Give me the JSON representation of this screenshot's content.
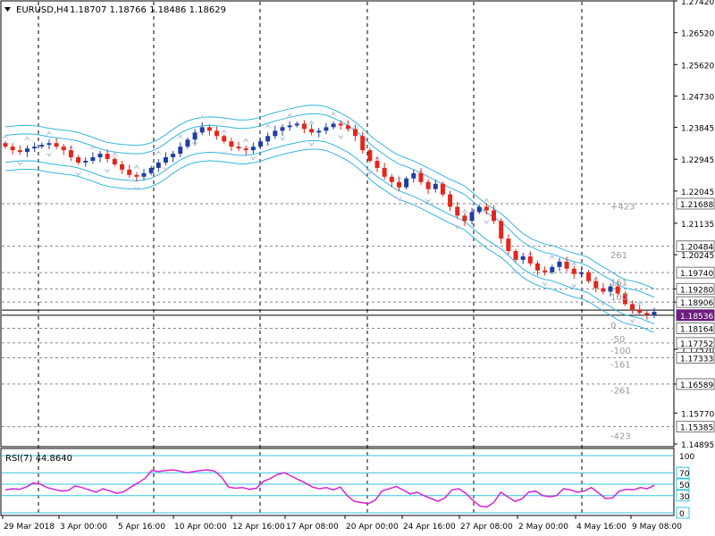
{
  "header": {
    "symbol_label": "EURUSD,H4",
    "ohlc": "1.18707 1.18766 1.18486 1.18629",
    "dropdown_icon": "triangle-down-icon"
  },
  "rsi_panel": {
    "label": "RSI(7) 44.8640",
    "levels": [
      "100",
      "70",
      "50",
      "30",
      "0"
    ],
    "highlighted_levels": [
      "70",
      "50",
      "30",
      "0"
    ]
  },
  "colors": {
    "bull_candle": "#1f3fa0",
    "bear_candle": "#e3261b",
    "bollinger": "#35b5e0",
    "fractal": "#b8c8df",
    "rsi_line": "#d424d4",
    "rsi_level": "#35c3e0",
    "price_label_bg": "#ffffff",
    "current_price_bg": "#6b1f7e"
  },
  "chart_data": {
    "type": "candlestick",
    "symbol": "EURUSD",
    "timeframe": "H4",
    "y_axis_ticks": [
      "1.27420",
      "1.26520",
      "1.25620",
      "1.24730",
      "1.23845",
      "1.22945",
      "1.22045",
      "1.21135",
      "1.20245",
      "1.19280",
      "1.18906",
      "1.17570",
      "1.16589",
      "1.15770",
      "1.14895"
    ],
    "x_axis_ticks": [
      "29 Mar 2018",
      "3 Apr 00:00",
      "5 Apr 16:00",
      "10 Apr 00:00",
      "12 Apr 16:00",
      "17 Apr 08:00",
      "20 Apr 00:00",
      "24 Apr 16:00",
      "27 Apr 08:00",
      "2 May 00:00",
      "4 May 16:00",
      "9 May 08:00"
    ],
    "price_labels": [
      {
        "value": "1.21688",
        "type": "level"
      },
      {
        "value": "1.20484",
        "type": "level"
      },
      {
        "value": "1.19740",
        "type": "level"
      },
      {
        "value": "1.19280",
        "type": "level"
      },
      {
        "value": "1.18906",
        "type": "level"
      },
      {
        "value": "1.18536",
        "type": "current"
      },
      {
        "value": "1.18164",
        "type": "level"
      },
      {
        "value": "1.17752",
        "type": "level"
      },
      {
        "value": "1.17333",
        "type": "level"
      },
      {
        "value": "1.16589",
        "type": "level"
      },
      {
        "value": "1.15385",
        "type": "level"
      }
    ],
    "fibo_labels": [
      {
        "text": "+423",
        "price": 1.2163
      },
      {
        "text": "261",
        "price": 1.2025
      },
      {
        "text": "161",
        "price": 1.1948
      },
      {
        "text": "100",
        "price": 1.1906
      },
      {
        "text": "0",
        "price": 1.1826
      },
      {
        "text": "-50",
        "price": 1.1788
      },
      {
        "text": "-100",
        "price": 1.1755
      },
      {
        "text": "-161",
        "price": 1.1715
      },
      {
        "text": "-261",
        "price": 1.1642
      },
      {
        "text": "-423",
        "price": 1.1514
      }
    ],
    "candles_close": [
      1.233,
      1.232,
      1.2315,
      1.2325,
      1.233,
      1.2335,
      1.234,
      1.233,
      1.232,
      1.23,
      1.2285,
      1.229,
      1.23,
      1.231,
      1.2295,
      1.228,
      1.2265,
      1.225,
      1.2245,
      1.2255,
      1.227,
      1.2285,
      1.23,
      1.231,
      1.233,
      1.235,
      1.237,
      1.2385,
      1.2375,
      1.236,
      1.2345,
      1.233,
      1.2325,
      1.232,
      1.233,
      1.2345,
      1.236,
      1.2375,
      1.2385,
      1.239,
      1.2395,
      1.238,
      1.237,
      1.2375,
      1.2385,
      1.2395,
      1.239,
      1.238,
      1.236,
      1.232,
      1.229,
      1.227,
      1.2245,
      1.223,
      1.2215,
      1.224,
      1.2255,
      1.223,
      1.221,
      1.2225,
      1.2195,
      1.216,
      1.2135,
      1.212,
      1.2145,
      1.216,
      1.215,
      1.212,
      1.207,
      1.2035,
      1.201,
      1.202,
      1.2,
      1.198,
      1.1975,
      1.199,
      1.2005,
      1.1985,
      1.197,
      1.1975,
      1.195,
      1.193,
      1.192,
      1.1935,
      1.1915,
      1.1885,
      1.187,
      1.186,
      1.1855,
      1.1863
    ],
    "rsi_values": [
      40,
      42,
      41,
      45,
      52,
      50,
      44,
      41,
      38,
      39,
      47,
      44,
      40,
      36,
      42,
      38,
      34,
      37,
      45,
      52,
      60,
      74,
      72,
      74,
      75,
      73,
      70,
      72,
      74,
      75,
      73,
      62,
      45,
      43,
      44,
      41,
      43,
      55,
      60,
      67,
      70,
      64,
      58,
      52,
      45,
      42,
      44,
      40,
      45,
      30,
      20,
      18,
      16,
      22,
      38,
      42,
      46,
      40,
      33,
      36,
      30,
      25,
      20,
      26,
      40,
      42,
      34,
      22,
      12,
      10,
      18,
      36,
      28,
      20,
      24,
      36,
      38,
      30,
      28,
      30,
      42,
      40,
      36,
      38,
      44,
      35,
      25,
      26,
      38,
      41,
      40,
      44,
      42,
      48
    ]
  }
}
